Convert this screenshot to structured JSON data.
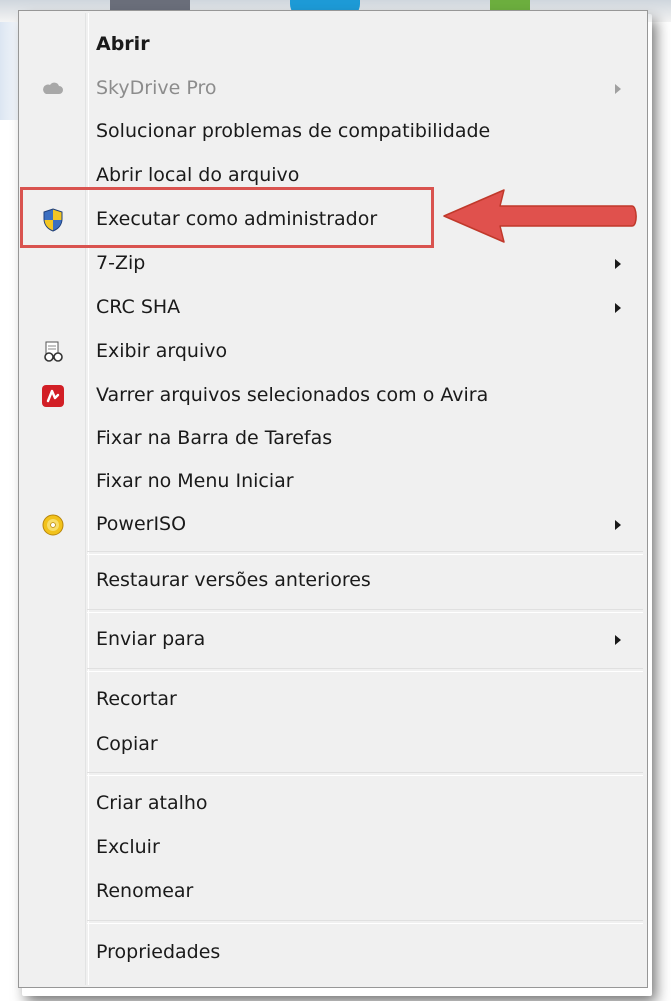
{
  "menu": {
    "items": [
      {
        "label": "Abrir",
        "bold": true
      },
      {
        "label": "SkyDrive Pro",
        "disabled": true,
        "icon": "cloud-icon",
        "submenu": true
      },
      {
        "label": "Solucionar problemas de compatibilidade"
      },
      {
        "label": "Abrir local do arquivo"
      },
      {
        "label": "Executar como administrador",
        "icon": "uac-shield-icon",
        "highlighted": true
      },
      {
        "label": "7-Zip",
        "submenu": true
      },
      {
        "label": "CRC SHA",
        "submenu": true
      },
      {
        "label": "Exibir arquivo",
        "icon": "view-file-icon"
      },
      {
        "label": "Varrer arquivos selecionados com o Avira",
        "icon": "avira-icon"
      },
      {
        "label": "Fixar na Barra de Tarefas"
      },
      {
        "label": "Fixar no Menu Iniciar"
      },
      {
        "label": "PowerISO",
        "icon": "poweriso-disc-icon",
        "submenu": true
      },
      {
        "label": "Restaurar versões anteriores"
      },
      {
        "label": "Enviar para",
        "submenu": true
      },
      {
        "label": "Recortar"
      },
      {
        "label": "Copiar"
      },
      {
        "label": "Criar atalho"
      },
      {
        "label": "Excluir"
      },
      {
        "label": "Renomear"
      },
      {
        "label": "Propriedades"
      }
    ]
  },
  "colors": {
    "annotation": "#d9534f",
    "menu_background": "#f0f0f0"
  }
}
